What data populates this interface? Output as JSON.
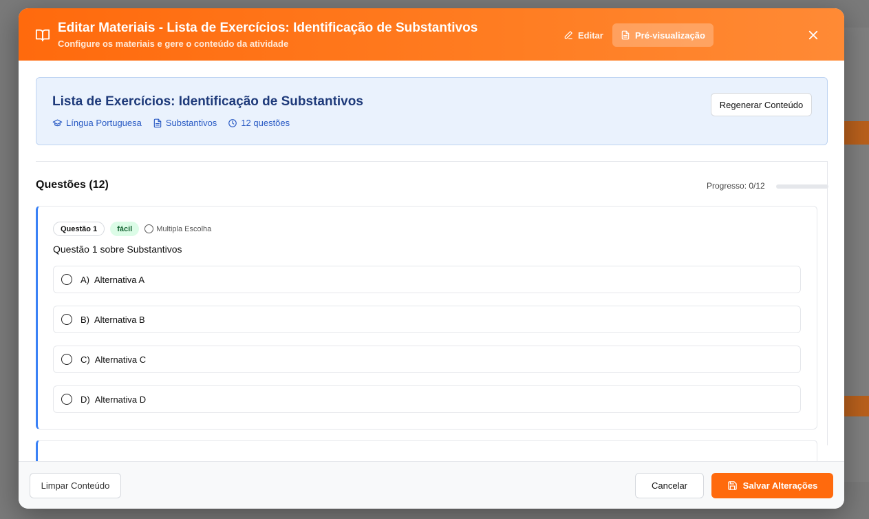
{
  "header": {
    "title": "Editar Materiais - Lista de Exercícios: Identificação de Substantivos",
    "subtitle": "Configure os materiais e gere o conteúdo da atividade",
    "edit_label": "Editar",
    "preview_label": "Pré-visualização",
    "icons": {
      "book": "book-open-icon",
      "edit": "pencil-icon",
      "preview": "file-text-icon",
      "close": "close-icon"
    }
  },
  "activity": {
    "title": "Lista de Exercícios: Identificação de Substantivos",
    "subject": "Língua Portuguesa",
    "topic": "Substantivos",
    "question_count": "12 questões",
    "regenerate_label": "Regenerar Conteúdo"
  },
  "questions_section": {
    "heading": "Questões (12)",
    "progress_label": "Progresso: 0/12",
    "progress_fraction": 0
  },
  "question1": {
    "number_badge": "Questão 1",
    "difficulty": "fácil",
    "type": "Multipla Escolha",
    "text": "Questão 1 sobre Substantivos",
    "options": [
      {
        "letter": "A)",
        "text": "Alternativa A"
      },
      {
        "letter": "B)",
        "text": "Alternativa B"
      },
      {
        "letter": "C)",
        "text": "Alternativa C"
      },
      {
        "letter": "D)",
        "text": "Alternativa D"
      }
    ]
  },
  "footer": {
    "clear_label": "Limpar Conteúdo",
    "cancel_label": "Cancelar",
    "save_label": "Salvar Alterações"
  },
  "colors": {
    "accent": "#ff6a0d",
    "info_bg": "#eaf2fd",
    "info_text": "#1e3a7a",
    "link_blue": "#2a5bc4",
    "easy_bg": "#dcfce7",
    "easy_text": "#166534"
  }
}
